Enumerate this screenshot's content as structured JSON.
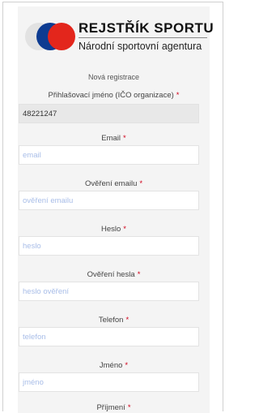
{
  "brand": {
    "title": "REJSTŘÍK SPORTU",
    "subtitle": "Národní sportovní agentura",
    "colors": {
      "grey": "#e2e2e2",
      "blue": "#0d3b91",
      "red": "#e3261c"
    }
  },
  "form": {
    "heading": "Nová registrace",
    "required_mark": "*",
    "login": {
      "label": "Přihlašovací jméno (IČO organizace)",
      "value": "48221247"
    },
    "email": {
      "label": "Email",
      "placeholder": "email"
    },
    "email_confirm": {
      "label": "Ověření emailu",
      "placeholder": "ověření emailu"
    },
    "password": {
      "label": "Heslo",
      "placeholder": "heslo"
    },
    "password_confirm": {
      "label": "Ověření hesla",
      "placeholder": "heslo ověření"
    },
    "phone": {
      "label": "Telefon",
      "placeholder": "telefon"
    },
    "first_name": {
      "label": "Jméno",
      "placeholder": "jméno"
    },
    "last_name": {
      "label": "Příjmení"
    }
  }
}
